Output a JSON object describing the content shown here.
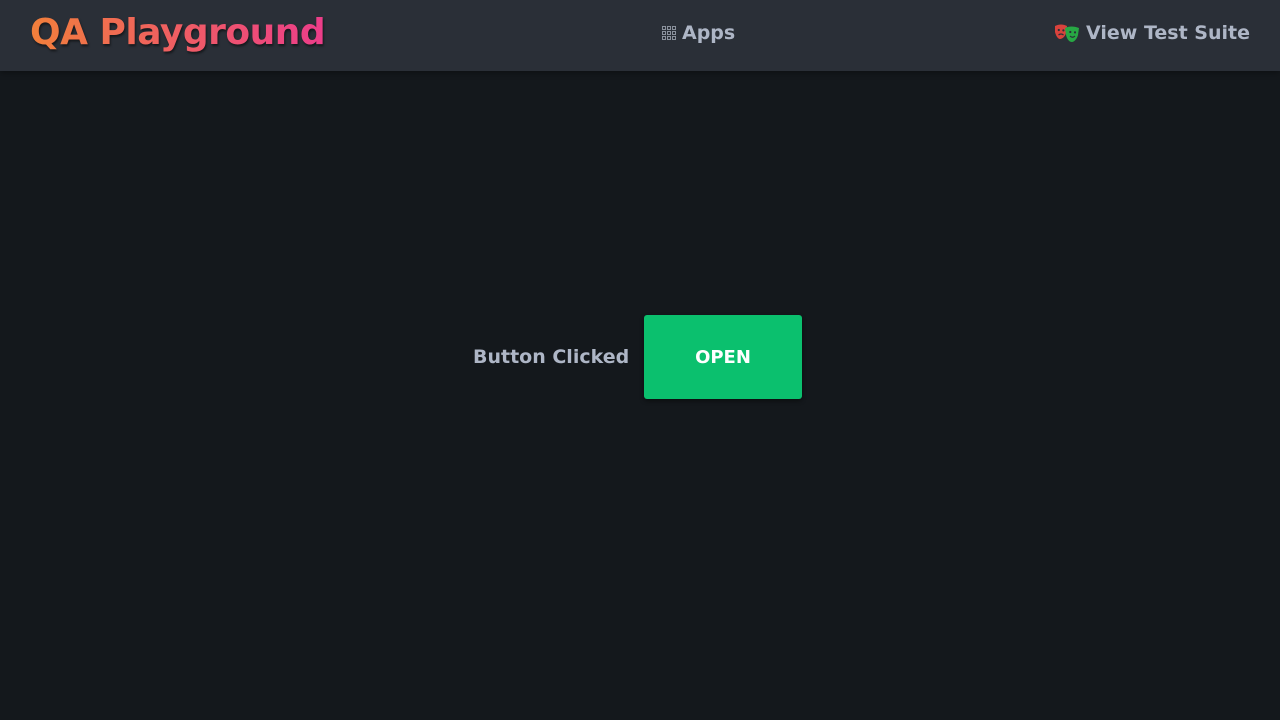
{
  "header": {
    "brand": "QA Playground",
    "nav": {
      "apps_label": "Apps",
      "apps_icon": "grid-icon",
      "suite_label": "View Test Suite",
      "suite_icon": "theater-masks-icon"
    }
  },
  "main": {
    "status_text": "Button Clicked",
    "button_label": "OPEN"
  },
  "colors": {
    "header_bg": "#2a2f37",
    "page_bg": "#14181c",
    "brand_gradient_start": "#f17f3b",
    "brand_gradient_end": "#ec3d8a",
    "nav_text": "#aeb6c6",
    "button_bg": "#0bc06e",
    "button_text": "#ffffff"
  }
}
